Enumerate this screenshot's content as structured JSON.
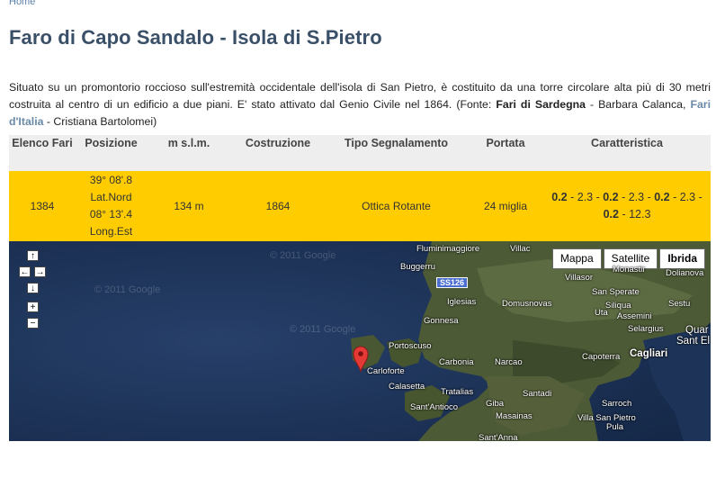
{
  "breadcrumb": "Home",
  "page_title": "Faro di Capo Sandalo - Isola di S.Pietro",
  "description": {
    "text1": "Situato su un promontorio roccioso sull'estremità occidentale dell'isola di San Pietro, è costituito da una torre circolare alta più di 30 metri costruita al centro di un edificio a due piani. E' stato attivato dal Genio Civile nel 1864. (Fonte: ",
    "source1": "Fari di Sardegna",
    "text2": " - Barbara Calanca, ",
    "source2_link": "Fari d'Italia",
    "text3": " - Cristiana Bartolomei)"
  },
  "table": {
    "headers": [
      "Elenco Fari",
      "Posizione",
      "m s.l.m.",
      "Costruzione",
      "Tipo Segnalamento",
      "Portata",
      "Caratteristica"
    ],
    "row": {
      "elenco": "1384",
      "lat": "39° 08'.8",
      "lat_label": "Lat.Nord",
      "long": "08° 13'.4",
      "long_label": "Long.Est",
      "altezza": "134 m",
      "costruzione": "1864",
      "tipo": "Ottica Rotante",
      "portata": "24 miglia",
      "car": [
        {
          "v": "0.2",
          "b": true
        },
        {
          "v": " - 2.3 - ",
          "b": false
        },
        {
          "v": "0.2",
          "b": true
        },
        {
          "v": " - 2.3 - ",
          "b": false
        },
        {
          "v": "0.2",
          "b": true
        },
        {
          "v": " - 2.3 -",
          "b": false
        },
        {
          "v": "0.2",
          "b": true
        },
        {
          "v": " - 12.3",
          "b": false
        }
      ]
    }
  },
  "map": {
    "types": [
      "Mappa",
      "Satellite",
      "Ibrida"
    ],
    "active_type": "Ibrida",
    "controls": {
      "up": "↑",
      "left": "←",
      "right": "→",
      "down": "↓",
      "zoom_in": "+",
      "zoom_out": "−"
    },
    "watermark": "© 2011 Google",
    "road": "SS126",
    "places": [
      "Fluminimaggiore",
      "Villac",
      "Buggerru",
      "Monastir",
      "Dolianova",
      "Villasor",
      "San Sperate",
      "Iglesias",
      "Domusnovas",
      "Siliqua",
      "Uta",
      "Assemini",
      "Gonnesa",
      "Sestu",
      "Selargius",
      "Quar",
      "Sant El",
      "Portoscuso",
      "Cagliari",
      "Carloforte",
      "Carbonia",
      "Narcao",
      "Capoterra",
      "Calasetta",
      "Tratalias",
      "Santadi",
      "Sant'Antioco",
      "Giba",
      "Sarroch",
      "Masainas",
      "Villa San Pietro",
      "Sant'Anna",
      "Pula"
    ]
  },
  "colors": {
    "title": "#3a5068",
    "table_row": "#ffcc00",
    "header_bg": "#eeeeee",
    "link": "#6a8aa8",
    "marker": "#e53935"
  }
}
